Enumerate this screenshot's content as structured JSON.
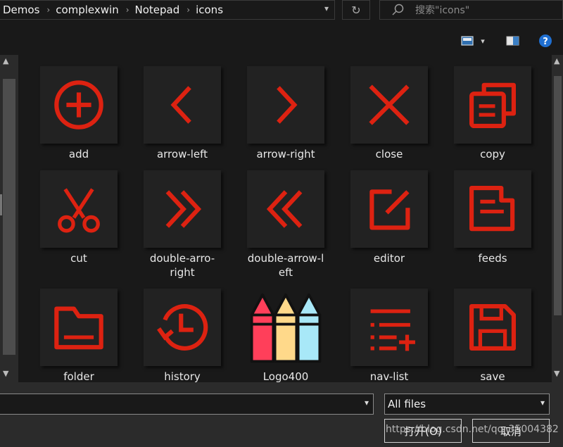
{
  "breadcrumb": [
    "Demos",
    "complexwin",
    "Notepad",
    "icons"
  ],
  "search": {
    "placeholder": "搜索\"icons\""
  },
  "colors": {
    "icon_red": "#dd2211",
    "bg": "#191919",
    "tile": "#222222"
  },
  "items": [
    {
      "label": "add",
      "icon": "add-icon"
    },
    {
      "label": "arrow-left",
      "icon": "arrow-left-icon"
    },
    {
      "label": "arrow-right",
      "icon": "arrow-right-icon"
    },
    {
      "label": "close",
      "icon": "close-icon"
    },
    {
      "label": "copy",
      "icon": "copy-icon"
    },
    {
      "label": "cut",
      "icon": "scissors-icon"
    },
    {
      "label": "double-arro-\nright",
      "icon": "double-arrow-right-icon"
    },
    {
      "label": "double-arrow-l\neft",
      "icon": "double-arrow-left-icon"
    },
    {
      "label": "editor",
      "icon": "edit-icon"
    },
    {
      "label": "feeds",
      "icon": "feeds-icon"
    },
    {
      "label": "folder",
      "icon": "folder-icon"
    },
    {
      "label": "history",
      "icon": "history-icon"
    },
    {
      "label": "Logo400",
      "icon": "crayons-logo-icon"
    },
    {
      "label": "nav-list",
      "icon": "nav-list-icon"
    },
    {
      "label": "save",
      "icon": "save-icon"
    }
  ],
  "filename": {
    "value": ""
  },
  "filetype": {
    "selected": "All files"
  },
  "buttons": {
    "open": "打开(O)",
    "cancel": "取消"
  },
  "watermark": "https://blog.csdn.net/qq_35004382"
}
